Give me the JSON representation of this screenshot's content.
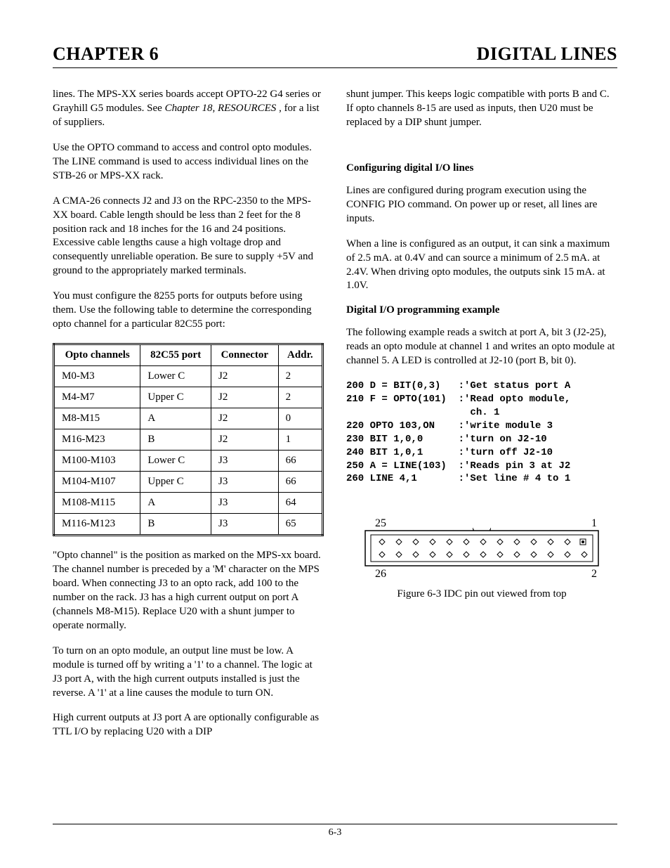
{
  "header": {
    "left": "CHAPTER 6",
    "right": "DIGITAL LINES"
  },
  "left_column": {
    "p1_a": "lines.  The MPS-XX series boards accept OPTO-22 G4 series or Grayhill G5 modules.  See ",
    "p1_i": "Chapter 18, RESOURCES",
    "p1_b": " , for a list of suppliers.",
    "p2": "Use the OPTO command to access and control opto modules.  The LINE command is used to access individual lines on the STB-26 or MPS-XX rack.",
    "p3": "A CMA-26 connects J2 and J3 on the RPC-2350 to the MPS-XX board.  Cable length should be less than 2 feet for the 8 position rack and 18 inches for the 16 and 24 positions.  Excessive cable lengths cause a high voltage drop and consequently unreliable operation.  Be sure to supply +5V and ground to the appropriately marked terminals.",
    "p4": "You must configure the 8255 ports for outputs before using them.  Use the following table to determine the corresponding opto channel for a particular 82C55 port:",
    "table": {
      "headers": [
        "Opto channels",
        "82C55 port",
        "Connector",
        "Addr."
      ],
      "rows": [
        [
          "M0-M3",
          "Lower C",
          "J2",
          "2"
        ],
        [
          "M4-M7",
          "Upper C",
          "J2",
          "2"
        ],
        [
          "M8-M15",
          "A",
          "J2",
          "0"
        ],
        [
          "M16-M23",
          "B",
          "J2",
          "1"
        ],
        [
          "M100-M103",
          "Lower C",
          "J3",
          "66"
        ],
        [
          "M104-M107",
          "Upper C",
          "J3",
          "66"
        ],
        [
          "M108-M115",
          "A",
          "J3",
          "64"
        ],
        [
          "M116-M123",
          "B",
          "J3",
          "65"
        ]
      ]
    },
    "p5": "\"Opto channel\" is the position as marked on the MPS-xx board.  The channel number is preceded by a 'M' character on the MPS board.  When connecting J3 to an opto rack, add 100 to the number on the rack.  J3 has a high current output on port A (channels M8-M15). Replace U20 with a shunt jumper to operate normally.",
    "p6": "To turn on an opto module, an output line must be low. A module is turned off by writing a '1' to a channel. The logic at J3 port A, with the high current outputs installed is just the reverse.  A '1' at a line causes the module to turn ON.",
    "p7": "High current outputs at J3 port A are optionally configurable as TTL I/O by replacing U20 with a DIP"
  },
  "right_column": {
    "p1": "shunt jumper.  This keeps logic compatible with ports B and C.  If opto channels 8-15 are used as inputs, then U20 must be replaced by a DIP shunt jumper.",
    "h1": "Configuring digital I/O lines",
    "p2": "Lines are configured during program execution using the CONFIG PIO command.  On power up or reset, all lines are inputs.",
    "p3": "When a line is configured as an output, it can sink a maximum of 2.5 mA. at 0.4V and can source a minimum of 2.5 mA. at 2.4V.  When driving opto modules, the outputs sink 15 mA. at 1.0V.",
    "h2": "Digital I/O programming example",
    "p4": "The following example reads a switch at port A, bit 3 (J2-25), reads an opto module at channel 1 and writes an opto module at channel 5.  A LED is controlled at J2-10 (port B, bit 0).",
    "code": "200 D = BIT(0,3)   :'Get status port A\n210 F = OPTO(101)  :'Read opto module,\n                     ch. 1\n220 OPTO 103,ON    :'write module 3\n230 BIT 1,0,0      :'turn on J2-10\n240 BIT 1,0,1      :'turn off J2-10\n250 A = LINE(103)  :'Reads pin 3 at J2\n260 LINE 4,1       :'Set line # 4 to 1",
    "figure": {
      "labels": {
        "tl": "25",
        "tr": "1",
        "bl": "26",
        "br": "2"
      },
      "caption": "Figure 6-3 IDC pin out viewed from top"
    }
  },
  "footer": {
    "page": "6-3"
  }
}
